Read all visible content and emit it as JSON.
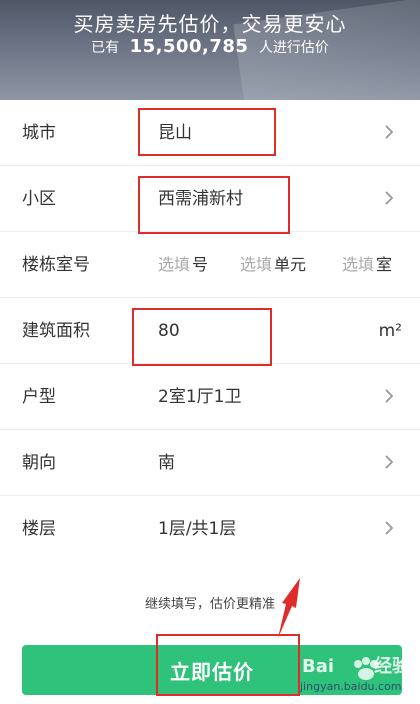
{
  "banner": {
    "title": "买房卖房先估价，交易更安心",
    "sub_prefix": "已有",
    "count": "15,500,785",
    "sub_suffix": "人进行估价"
  },
  "form": {
    "city": {
      "label": "城市",
      "value": "昆山"
    },
    "community": {
      "label": "小区",
      "value": "西需浦新村"
    },
    "room": {
      "label": "楼栋室号",
      "parts": [
        {
          "placeholder": "选填",
          "unit": "号"
        },
        {
          "placeholder": "选填",
          "unit": "单元"
        },
        {
          "placeholder": "选填",
          "unit": "室"
        }
      ]
    },
    "area": {
      "label": "建筑面积",
      "value": "80",
      "unit": "m²"
    },
    "layout": {
      "label": "户型",
      "value": "2室1厅1卫"
    },
    "orientation": {
      "label": "朝向",
      "value": "南"
    },
    "floor": {
      "label": "楼层",
      "value": "1层/共1层"
    }
  },
  "hint": "继续填写，估价更精准",
  "cta_label": "立即估价",
  "watermark": {
    "brand": "Bai",
    "product": "经验",
    "url": "jingyan.baidu.com"
  },
  "colors": {
    "accent": "#2fc27a",
    "highlight": "#e02b2b"
  },
  "icons": {
    "row_arrow": "chevron-right-icon"
  }
}
